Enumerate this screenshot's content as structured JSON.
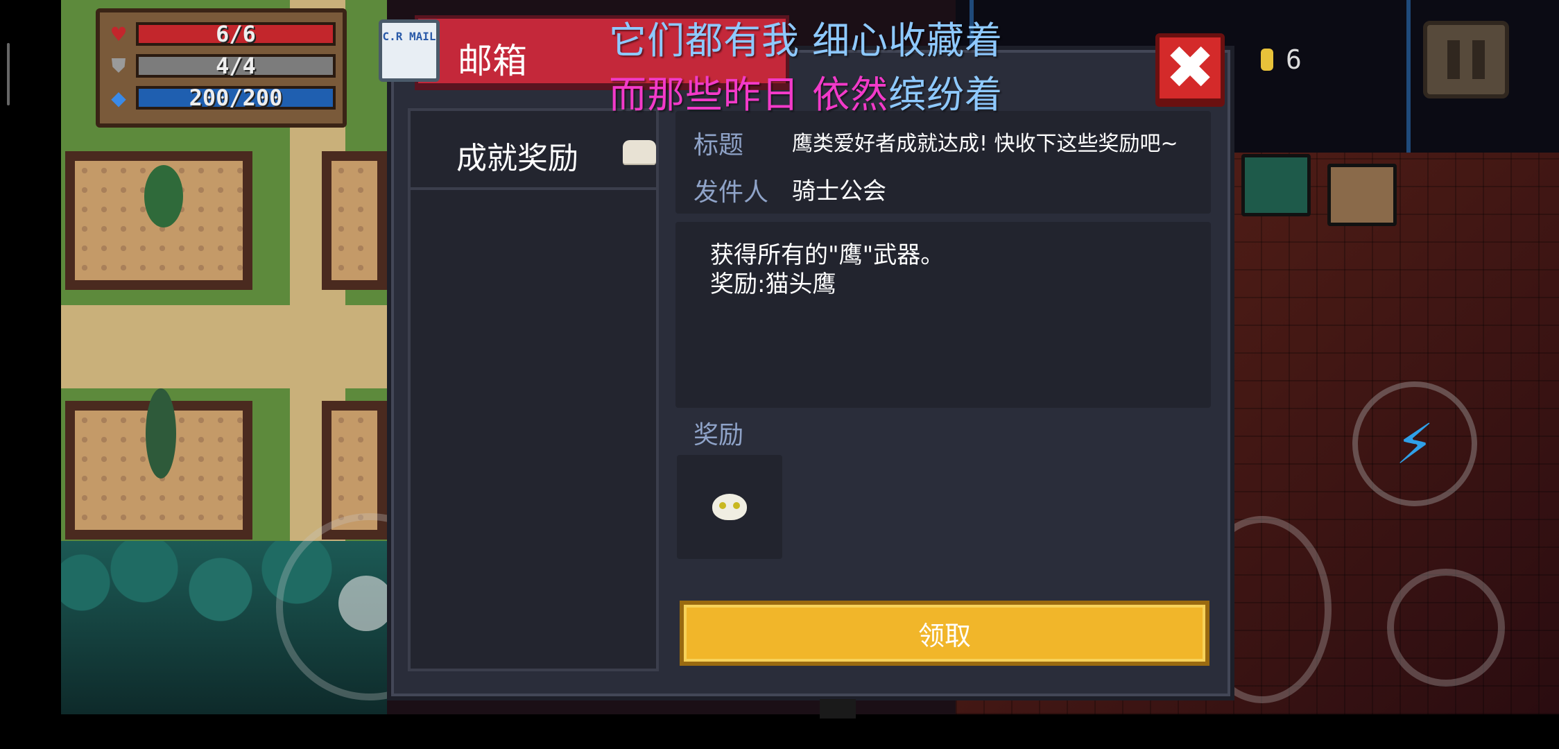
{
  "hud": {
    "hp": "6/6",
    "armor": "4/4",
    "energy": "200/200",
    "coins": "6",
    "hp_icon": "heart-icon",
    "armor_icon": "shield-icon",
    "energy_icon": "diamond-icon",
    "hp_color": "#c3262c",
    "armor_color": "#7c7c7c",
    "energy_color": "#1f5fb0"
  },
  "lyrics": {
    "line1": "它们都有我 细心收藏着",
    "line2_part1": "而那些昨日 依然",
    "line2_part2": "缤纷着"
  },
  "mailbox": {
    "title": "邮箱",
    "mail_icon_text": "C.R MAIL",
    "list": [
      {
        "label": "成就奖励"
      }
    ],
    "subject_label": "标题",
    "subject": "鹰类爱好者成就达成! 快收下这些奖励吧~",
    "sender_label": "发件人",
    "sender": "骑士公会",
    "body": [
      "获得所有的\"鹰\"武器。",
      "奖励:猫头鹰"
    ],
    "reward_label": "奖励",
    "claim_button": "领取",
    "close_symbol": "✖"
  },
  "colors": {
    "accent_red": "#c4283a",
    "claim_yellow": "#f1b62a",
    "lyric_blue": "#8ec9ff",
    "lyric_pink": "#f23ac9"
  }
}
